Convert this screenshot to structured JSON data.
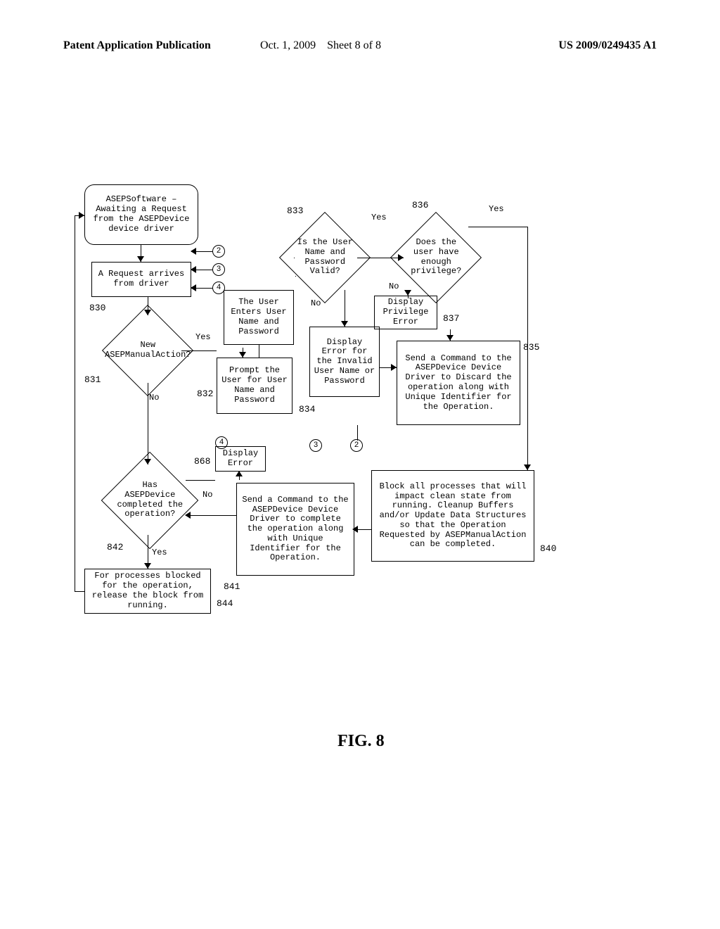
{
  "header": {
    "left": "Patent Application Publication",
    "mid_date": "Oct. 1, 2009",
    "mid_sheet": "Sheet 8 of 8",
    "right": "US 2009/0249435 A1"
  },
  "figure": {
    "label_prefix": "FIG.",
    "label_number": "8"
  },
  "nodes": {
    "state_start": "ASEPSoftware – Awaiting a Request from the ASEPDevice device driver",
    "box_830": "A Request arrives from driver",
    "dia_831": "New ASEPManualAction?",
    "box_832": "Prompt the User for User Name and Password",
    "box_user_enters": "The User Enters User Name and Password",
    "dia_833": "Is the User Name and Password Valid?",
    "dia_836": "Does the user have enough privilege?",
    "box_837": "Display Privilege Error",
    "box_834": "Display Error for the Invalid User Name or Password",
    "box_835": "Send a Command to the ASEPDevice Device Driver to Discard the operation along with Unique Identifier for the Operation.",
    "box_840": "Block all processes that will impact clean state from running. Cleanup Buffers and/or Update Data Structures so that the Operation Requested by ASEPManualAction can be completed.",
    "box_841": "Send a Command to the ASEPDevice Device Driver to complete the operation along with Unique Identifier for the Operation.",
    "dia_842": "Has ASEPDevice completed the operation?",
    "box_844": "For processes blocked for the operation, release the block from running.",
    "box_868": "Display Error"
  },
  "refs": {
    "r830": "830",
    "r831": "831",
    "r832": "832",
    "r833": "833",
    "r834": "834",
    "r835": "835",
    "r836": "836",
    "r837": "837",
    "r840": "840",
    "r841": "841",
    "r842": "842",
    "r844": "844",
    "r868": "868"
  },
  "edges": {
    "yes": "Yes",
    "no": "No"
  },
  "connectors": {
    "c2": "2",
    "c3": "3",
    "c4": "4"
  }
}
